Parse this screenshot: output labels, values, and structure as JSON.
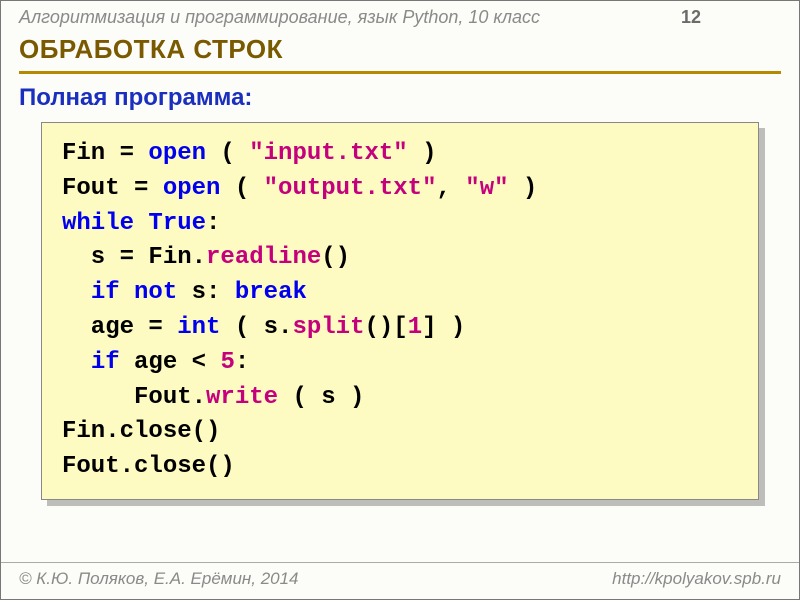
{
  "header": {
    "title": "Алгоритмизация и программирование, язык Python, 10 класс",
    "page": "12"
  },
  "section_title": "ОБРАБОТКА СТРОК",
  "sub_title": "Полная программа:",
  "code": {
    "l1_a": "Fin = ",
    "l1_kw": "open",
    "l1_b": " ( ",
    "l1_str": "\"input.txt\"",
    "l1_c": " )",
    "l2_a": "Fout = ",
    "l2_kw": "open",
    "l2_b": " ( ",
    "l2_str1": "\"output.txt\"",
    "l2_c": ", ",
    "l2_str2": "\"w\"",
    "l2_d": " )",
    "l3_kw1": "while",
    "l3_sp": " ",
    "l3_kw2": "True",
    "l3_c": ":",
    "l4_a": "  s = Fin.",
    "l4_fn": "readline",
    "l4_b": "()",
    "l5_a": "  ",
    "l5_kw1": "if",
    "l5_b": " ",
    "l5_kw2": "not",
    "l5_c": " s: ",
    "l5_kw3": "break",
    "l6_a": "  age = ",
    "l6_kw": "int",
    "l6_b": " ( s.",
    "l6_fn": "split",
    "l6_c": "()[",
    "l6_num": "1",
    "l6_d": "] )",
    "l7_a": "  ",
    "l7_kw": "if",
    "l7_b": " age < ",
    "l7_num": "5",
    "l7_c": ":",
    "l8_a": "     Fout.",
    "l8_fn": "write",
    "l8_b": " ( s )",
    "l9": "Fin.close()",
    "l10": "Fout.close()"
  },
  "footer": {
    "left": "© К.Ю. Поляков, Е.А. Ерёмин, 2014",
    "right": "http://kpolyakov.spb.ru"
  }
}
